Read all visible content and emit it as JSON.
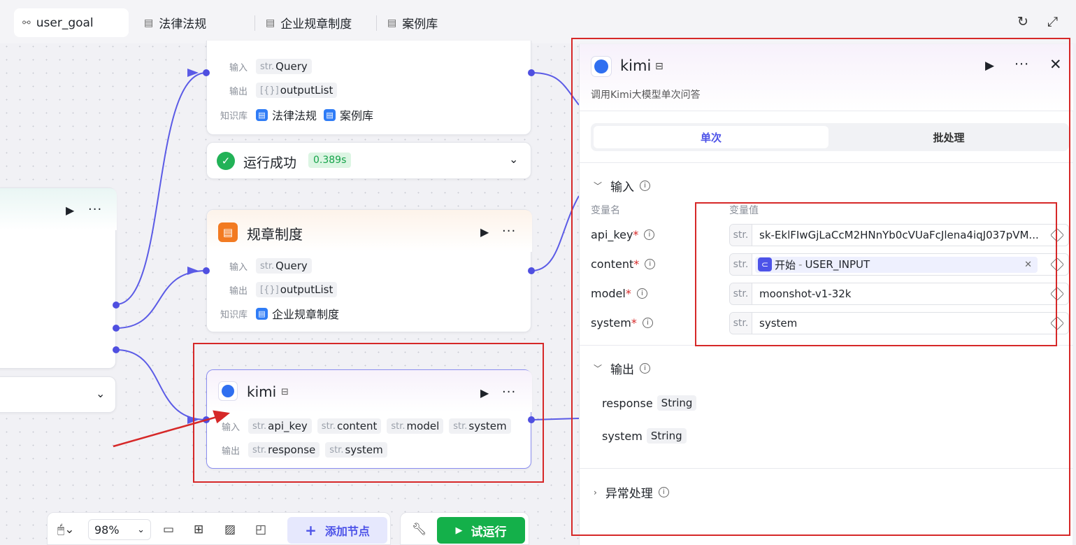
{
  "tabs": [
    {
      "label": "user_goal",
      "active": true
    },
    {
      "label": "法律法规"
    },
    {
      "label": "企业规章制度"
    },
    {
      "label": "案例库"
    }
  ],
  "labels": {
    "input": "输入",
    "output": "输出",
    "kb": "知识库",
    "str": "str."
  },
  "node_top": {
    "inputs": [
      "Query"
    ],
    "outputs": [
      "outputList"
    ],
    "knowledge": [
      "法律法规",
      "案例库"
    ],
    "run_status": "运行成功",
    "run_time": "0.389s"
  },
  "node_rule": {
    "title": "规章制度",
    "inputs": [
      "Query"
    ],
    "outputs": [
      "outputList"
    ],
    "knowledge": [
      "企业规章制度"
    ]
  },
  "node_kimi": {
    "title": "kimi",
    "inputs": [
      "api_key",
      "content",
      "model",
      "system"
    ],
    "outputs": [
      "response",
      "system"
    ]
  },
  "panel": {
    "title": "kimi",
    "description": "调用Kimi大模型单次问答",
    "seg_single": "单次",
    "seg_batch": "批处理",
    "input_section": "输入",
    "col_name": "变量名",
    "col_value": "变量值",
    "params": [
      {
        "name": "api_key",
        "value": "sk-EklFIwGjLaCcM2HNnYb0cVUaFcJlena4iqJ037pVM..."
      },
      {
        "name": "content",
        "ref_node": "开始",
        "ref_var": "USER_INPUT"
      },
      {
        "name": "model",
        "value": "moonshot-v1-32k"
      },
      {
        "name": "system",
        "value": "system"
      }
    ],
    "output_section": "输出",
    "outputs": [
      {
        "name": "response",
        "type": "String"
      },
      {
        "name": "system",
        "type": "String"
      }
    ],
    "error_section": "异常处理"
  },
  "toolbar": {
    "zoom": "98%",
    "add_node": "添加节点",
    "trial_run": "试运行"
  },
  "colors": {
    "accent": "#4d53e8",
    "success": "#14b04a",
    "annotation": "#d62828"
  }
}
